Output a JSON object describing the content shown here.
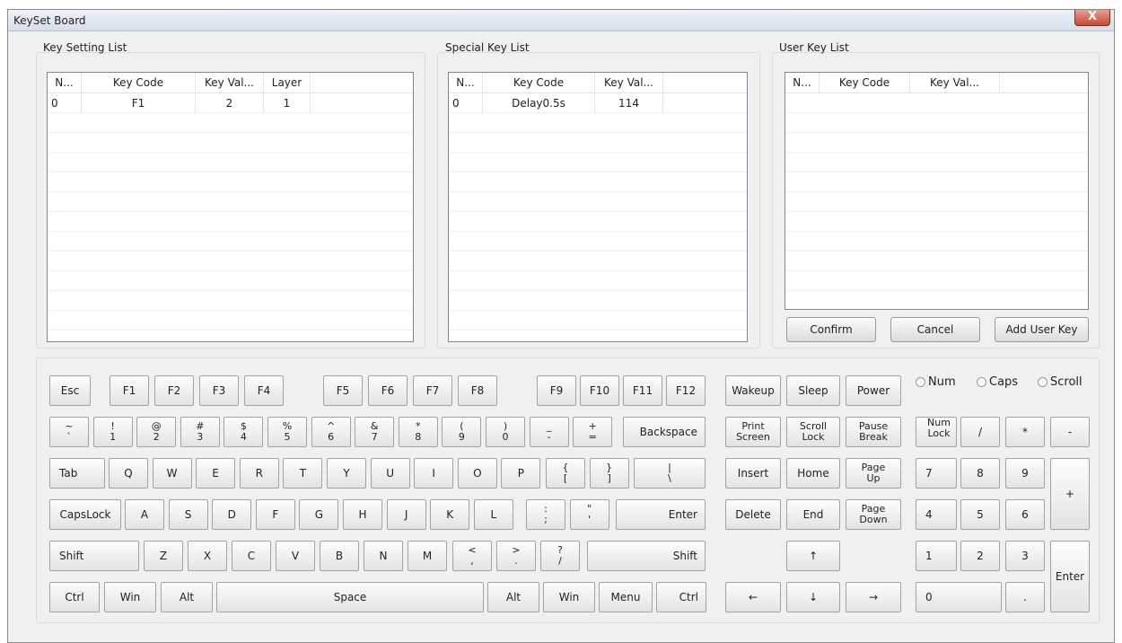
{
  "window": {
    "title": "KeySet Board",
    "close_label": "X"
  },
  "key_setting": {
    "label": "Key Setting List",
    "columns": [
      "N...",
      "Key Code",
      "Key Val...",
      "Layer"
    ],
    "rows": [
      [
        "0",
        "F1",
        "2",
        "1"
      ]
    ]
  },
  "special_key": {
    "label": "Special Key List",
    "columns": [
      "N...",
      "Key Code",
      "Key Val..."
    ],
    "rows": [
      [
        "0",
        "Delay0.5s",
        "114"
      ]
    ]
  },
  "user_key": {
    "label": "User Key List",
    "columns": [
      "N...",
      "Key Code",
      "Key Val..."
    ],
    "rows": []
  },
  "buttons": {
    "confirm": "Confirm",
    "cancel": "Cancel",
    "add_user_key": "Add User Key"
  },
  "toggles": {
    "num": "Num",
    "caps": "Caps",
    "scroll": "Scroll"
  },
  "keys": {
    "row1": [
      "Esc",
      "F1",
      "F2",
      "F3",
      "F4",
      "F5",
      "F6",
      "F7",
      "F8",
      "F9",
      "F10",
      "F11",
      "F12"
    ],
    "row2": [
      [
        "~",
        "`"
      ],
      [
        "!",
        "1"
      ],
      [
        "@",
        "2"
      ],
      [
        "#",
        "3"
      ],
      [
        "$",
        "4"
      ],
      [
        "%",
        "5"
      ],
      [
        "^",
        "6"
      ],
      [
        "&",
        "7"
      ],
      [
        "*",
        "8"
      ],
      [
        "(",
        "9"
      ],
      [
        ")",
        "0"
      ],
      [
        "_",
        "-"
      ],
      [
        "+",
        "="
      ]
    ],
    "backspace": "Backspace",
    "tab": "Tab",
    "row3": [
      "Q",
      "W",
      "E",
      "R",
      "T",
      "Y",
      "U",
      "I",
      "O",
      "P"
    ],
    "row3b": [
      [
        "{",
        "["
      ],
      [
        "}",
        "]"
      ],
      [
        "|",
        "\\"
      ]
    ],
    "capslock": "CapsLock",
    "row4": [
      "A",
      "S",
      "D",
      "F",
      "G",
      "H",
      "J",
      "K",
      "L"
    ],
    "row4b": [
      [
        ":",
        ";"
      ],
      [
        "\"",
        "'"
      ]
    ],
    "enter": "Enter",
    "shift": "Shift",
    "row5": [
      "Z",
      "X",
      "C",
      "V",
      "B",
      "N",
      "M"
    ],
    "row5b": [
      [
        "<",
        ","
      ],
      [
        ">",
        "."
      ],
      [
        "?",
        "/"
      ]
    ],
    "ctrl": "Ctrl",
    "win": "Win",
    "alt": "Alt",
    "space": "Space",
    "menu": "Menu",
    "nav": {
      "wakeup": "Wakeup",
      "sleep": "Sleep",
      "power": "Power",
      "print": [
        "Print",
        "Screen"
      ],
      "scroll": [
        "Scroll",
        "Lock"
      ],
      "pause": [
        "Pause",
        "Break"
      ],
      "insert": "Insert",
      "home": "Home",
      "pgup": [
        "Page",
        "Up"
      ],
      "delete": "Delete",
      "end": "End",
      "pgdn": [
        "Page",
        "Down"
      ],
      "up": "↑",
      "left": "←",
      "down": "↓",
      "right": "→"
    },
    "numpad": {
      "numlock": [
        "Num",
        "Lock"
      ],
      "div": "/",
      "mul": "*",
      "minus": "-",
      "n7": "7",
      "n8": "8",
      "n9": "9",
      "plus": "+",
      "n4": "4",
      "n5": "5",
      "n6": "6",
      "n1": "1",
      "n2": "2",
      "n3": "3",
      "enter": "Enter",
      "n0": "0",
      "dot": "."
    }
  }
}
